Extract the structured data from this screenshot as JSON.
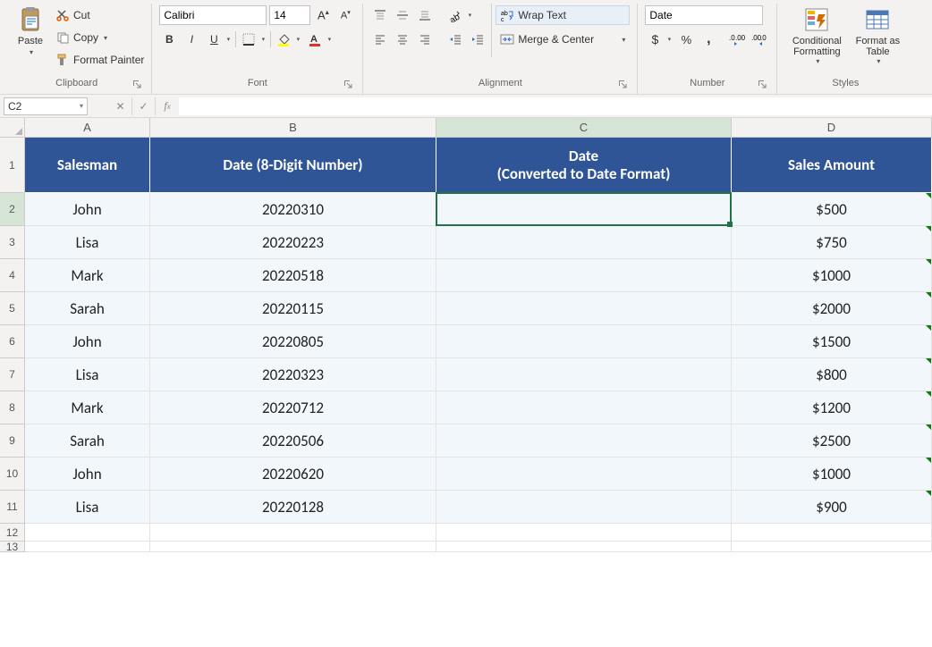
{
  "ribbon": {
    "clipboard": {
      "paste": "Paste",
      "cut": "Cut",
      "copy": "Copy",
      "format_painter": "Format Painter",
      "group_label": "Clipboard"
    },
    "font": {
      "name": "Calibri",
      "size": "14",
      "group_label": "Font"
    },
    "alignment": {
      "wrap_text": "Wrap Text",
      "merge_center": "Merge & Center",
      "group_label": "Alignment"
    },
    "number": {
      "format": "Date",
      "group_label": "Number"
    },
    "styles": {
      "conditional": "Conditional\nFormatting",
      "format_table": "Format as\nTable",
      "group_label": "Styles"
    }
  },
  "namebox": "C2",
  "formula": "",
  "columns": [
    "A",
    "B",
    "C",
    "D"
  ],
  "headers": {
    "A": "Salesman",
    "B": "Date (8-Digit Number)",
    "C": "Date\n(Converted to Date Format)",
    "D": "Sales Amount"
  },
  "rows": [
    {
      "A": "John",
      "B": "20220310",
      "C": "",
      "D": "$500"
    },
    {
      "A": "Lisa",
      "B": "20220223",
      "C": "",
      "D": "$750"
    },
    {
      "A": "Mark",
      "B": "20220518",
      "C": "",
      "D": "$1000"
    },
    {
      "A": "Sarah",
      "B": "20220115",
      "C": "",
      "D": "$2000"
    },
    {
      "A": "John",
      "B": "20220805",
      "C": "",
      "D": "$1500"
    },
    {
      "A": "Lisa",
      "B": "20220323",
      "C": "",
      "D": "$800"
    },
    {
      "A": "Mark",
      "B": "20220712",
      "C": "",
      "D": "$1200"
    },
    {
      "A": "Sarah",
      "B": "20220506",
      "C": "",
      "D": "$2500"
    },
    {
      "A": "John",
      "B": "20220620",
      "C": "",
      "D": "$1000"
    },
    {
      "A": "Lisa",
      "B": "20220128",
      "C": "",
      "D": "$900"
    }
  ],
  "active_cell": "C2"
}
